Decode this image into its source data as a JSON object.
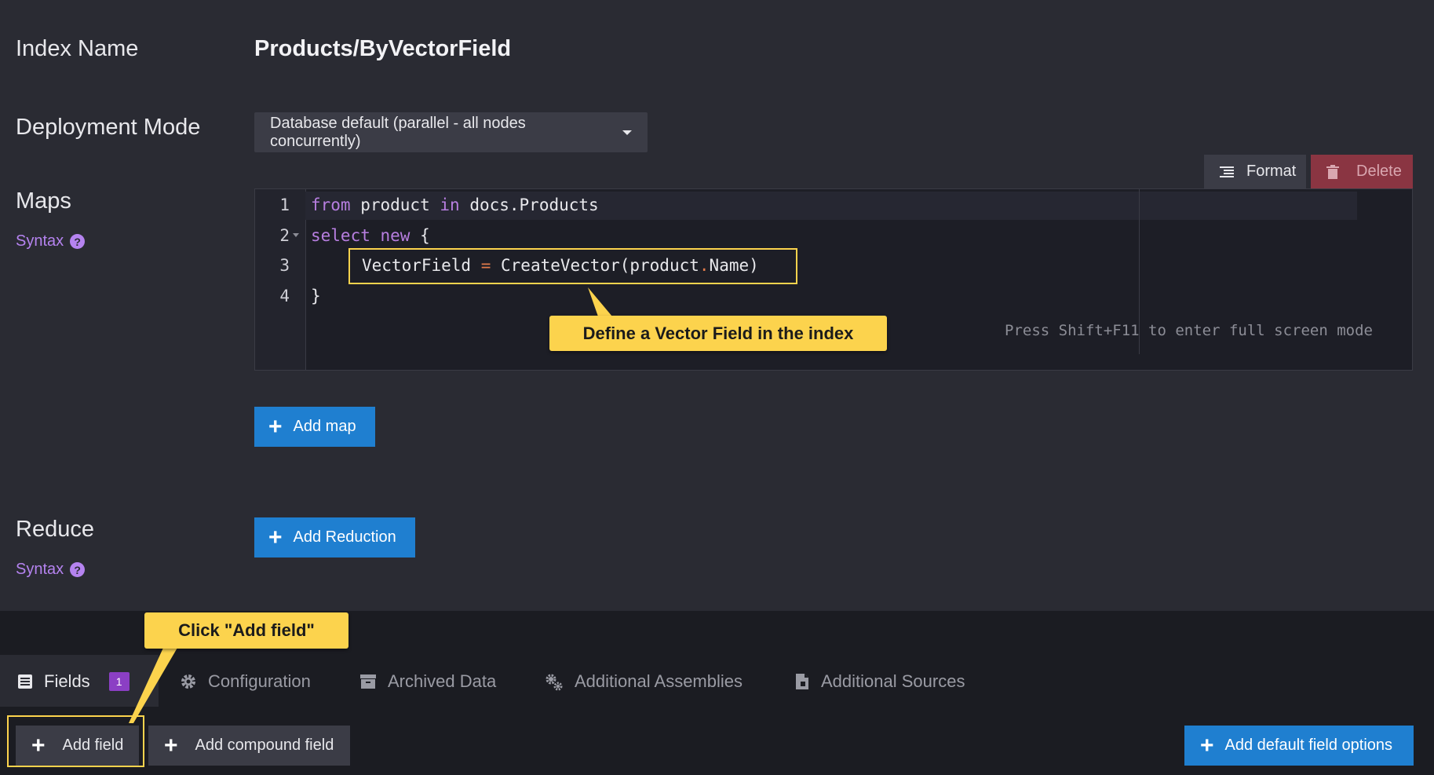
{
  "labels": {
    "index_name": "Index Name",
    "deployment_mode": "Deployment Mode",
    "maps": "Maps",
    "reduce": "Reduce",
    "syntax": "Syntax"
  },
  "index_name_value": "Products/ByVectorField",
  "deployment_mode_value": "Database default (parallel - all nodes concurrently)",
  "toolbar": {
    "format_label": "Format",
    "delete_label": "Delete"
  },
  "editor": {
    "line_numbers": [
      "1",
      "2",
      "3",
      "4"
    ],
    "lines": {
      "l1_kw1": "from",
      "l1_t1": " product ",
      "l1_kw2": "in",
      "l1_t2": " docs.Products",
      "l2_kw1": "select",
      "l2_t1": " ",
      "l2_kw2": "new",
      "l2_t2": " {",
      "l3_a": "VectorField ",
      "l3_op": "=",
      "l3_b": " CreateVector(product",
      "l3_dot": ".",
      "l3_c": "Name)",
      "l4": "}"
    },
    "fullscreen_hint": "Press Shift+F11 to enter full screen mode"
  },
  "callouts": {
    "vector_field": "Define a Vector Field in the index",
    "add_field": "Click \"Add field\""
  },
  "buttons": {
    "add_map": "Add map",
    "add_reduction": "Add Reduction",
    "add_field": "Add field",
    "add_compound_field": "Add compound field",
    "add_default_field_options": "Add default field options"
  },
  "tabs": [
    {
      "label": "Fields",
      "icon": "list-icon",
      "badge": "1"
    },
    {
      "label": "Configuration",
      "icon": "gear-icon"
    },
    {
      "label": "Archived Data",
      "icon": "archive-icon"
    },
    {
      "label": "Additional Assemblies",
      "icon": "gears-icon"
    },
    {
      "label": "Additional Sources",
      "icon": "file-icon"
    }
  ],
  "colors": {
    "background": "#2a2b33",
    "accent_blue": "#1f7fd0",
    "callout_yellow": "#fcd34d",
    "syntax_purple": "#b583f0",
    "delete_red": "#8a3542"
  }
}
